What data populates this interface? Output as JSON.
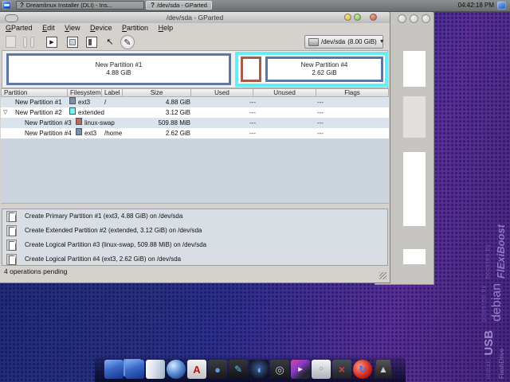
{
  "taskbar": {
    "tasks": [
      {
        "icon": "?",
        "label": "Dreamlinux Installer (DLI) - Ins..."
      },
      {
        "icon": "?",
        "label": "/dev/sda - GParted"
      }
    ],
    "clock": "04:42:18 PM"
  },
  "window": {
    "title": "/dev/sda - GParted",
    "menu": {
      "items": [
        "GParted",
        "Edit",
        "View",
        "Device",
        "Partition",
        "Help"
      ]
    },
    "toolbar": {
      "icons": [
        {
          "name": "new-partition",
          "glyph": ""
        },
        {
          "name": "delete-partition",
          "glyph": ""
        },
        {
          "name": "resize-move",
          "glyph": "▶"
        },
        {
          "name": "copy",
          "glyph": ""
        },
        {
          "name": "paste",
          "glyph": ""
        },
        {
          "name": "undo",
          "glyph": "↖"
        },
        {
          "name": "apply",
          "glyph": "✎"
        }
      ],
      "device_label": "/dev/sda",
      "device_size": "(8.00 GiB)",
      "dropdown_glyph": "▼"
    },
    "visual": {
      "p1_name": "New Partition #1",
      "p1_size": "4.88 GiB",
      "p4_name": "New Partition #4",
      "p4_size": "2.62 GiB"
    },
    "table": {
      "headers": [
        "Partition",
        "Filesystem",
        "Label",
        "Size",
        "Used",
        "Unused",
        "Flags"
      ],
      "rows": [
        {
          "name": "New Partition #1",
          "fs": "ext3",
          "label": "/",
          "size": "4.88 GiB",
          "used": "---",
          "unused": "---",
          "flags": ""
        },
        {
          "name": "New Partition #2",
          "expander": "▽",
          "fs": "extended",
          "label": "",
          "size": "3.12 GiB",
          "used": "---",
          "unused": "---",
          "flags": ""
        },
        {
          "name": "New Partition #3",
          "fs": "linux-swap",
          "label": "",
          "size": "509.88 MiB",
          "used": "---",
          "unused": "---",
          "flags": ""
        },
        {
          "name": "New Partition #4",
          "fs": "ext3",
          "label": "/home",
          "size": "2.62 GiB",
          "used": "---",
          "unused": "---",
          "flags": ""
        }
      ]
    },
    "operations": [
      {
        "text": "Create Primary Partition #1 (ext3, 4.88 GiB) on /dev/sda"
      },
      {
        "text": "Create Extended Partition #2 (extended, 3.12 GiB) on /dev/sda"
      },
      {
        "text": "Create Logical Partition #3 (linux-swap, 509.88 MiB) on /dev/sda"
      },
      {
        "text": "Create Logical Partition #4 (ext3, 2.62 GiB) on /dev/sda"
      }
    ],
    "status": "4 operations pending"
  },
  "colors": {
    "ext3_swatch": "#7590ae",
    "extended_swatch": "#73f3f7",
    "linux_swap_swatch": "#c1665a",
    "extended_border": "#62eef4",
    "primary_border": "#5c77a4",
    "swap_border": "#aa5a4a",
    "titlebar_buttons": [
      "#e3b53a",
      "#7ec04f",
      "#cf4e42"
    ]
  },
  "desktop": {
    "watermarks": {
      "flexiboost": {
        "small": "boosted by",
        "big": "FlExiBoost"
      },
      "debian": {
        "small": "powered by",
        "big": "debian"
      },
      "usb": {
        "small": "install",
        "big": "USB",
        "sub": "FlashDrive"
      }
    }
  },
  "dock": {
    "icons": [
      {
        "name": "desktop",
        "glyph": ""
      },
      {
        "name": "displays",
        "glyph": ""
      },
      {
        "name": "file-manager",
        "glyph": ""
      },
      {
        "name": "web-browser",
        "glyph": ""
      },
      {
        "name": "pdf-reader",
        "glyph": "A"
      },
      {
        "name": "disc-burner",
        "glyph": "●"
      },
      {
        "name": "media-editor",
        "glyph": "✎"
      },
      {
        "name": "audio-player",
        "glyph": "◖"
      },
      {
        "name": "volume-control",
        "glyph": "◎"
      },
      {
        "name": "totem-player",
        "glyph": "▸"
      },
      {
        "name": "package-installer",
        "glyph": "○"
      },
      {
        "name": "system-tools",
        "glyph": "×"
      },
      {
        "name": "software-updater",
        "glyph": "↻"
      },
      {
        "name": "eject",
        "glyph": "▲"
      }
    ]
  }
}
